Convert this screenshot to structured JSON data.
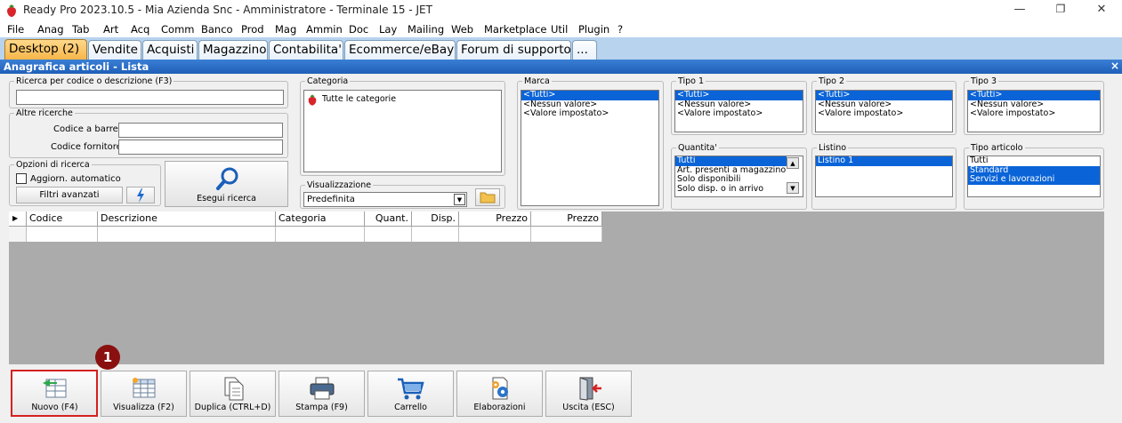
{
  "window": {
    "title": "Ready Pro 2023.10.5 - Mia Azienda Snc - Amministratore - Terminale 15 - JET",
    "minimize": "—",
    "restore": "❐",
    "close": "✕"
  },
  "menu": [
    "File",
    "Anag",
    "Tab",
    "Art",
    "Acq",
    "Comm",
    "Banco",
    "Prod",
    "Mag",
    "Ammin",
    "Doc",
    "Lay",
    "Mailing",
    "Web",
    "Marketplace",
    "Util",
    "Plugin",
    "?"
  ],
  "tabs": [
    "Desktop (2)",
    "Vendite",
    "Acquisti",
    "Magazzino",
    "Contabilita'",
    "Ecommerce/eBay",
    "Forum di supporto",
    "..."
  ],
  "panel": {
    "title": "Anagrafica articoli  - Lista",
    "close": "×"
  },
  "search": {
    "legend": "Ricerca per codice o descrizione (F3)",
    "value": ""
  },
  "other_search": {
    "legend": "Altre ricerche",
    "barcode_label": "Codice a barre :",
    "supplier_label": "Codice fornitore :"
  },
  "search_options": {
    "legend": "Opzioni di ricerca",
    "auto_update_label": "Aggiorn. automatico",
    "advanced_filters": "Filtri avanzati"
  },
  "search_button": "Esegui ricerca",
  "category": {
    "legend": "Categoria",
    "item": "Tutte le categorie"
  },
  "view": {
    "legend": "Visualizzazione",
    "value": "Predefinita"
  },
  "brand": {
    "legend": "Marca",
    "items": [
      "<Tutti>",
      "<Nessun valore>",
      "<Valore impostato>"
    ],
    "selected": 0
  },
  "type1": {
    "legend": "Tipo 1",
    "items": [
      "<Tutti>",
      "<Nessun valore>",
      "<Valore impostato>"
    ],
    "selected": 0
  },
  "type2": {
    "legend": "Tipo 2",
    "items": [
      "<Tutti>",
      "<Nessun valore>",
      "<Valore impostato>"
    ],
    "selected": 0
  },
  "type3": {
    "legend": "Tipo 3",
    "items": [
      "<Tutti>",
      "<Nessun valore>",
      "<Valore impostato>"
    ],
    "selected": 0
  },
  "quantity": {
    "legend": "Quantita'",
    "items": [
      "Tutti",
      "Art. presenti a magazzino",
      "Solo disponibili",
      "Solo disp. o in arrivo"
    ],
    "selected": 0
  },
  "pricelist": {
    "legend": "Listino",
    "items": [
      "Listino 1"
    ],
    "selected": 0
  },
  "article_type": {
    "legend": "Tipo articolo",
    "items": [
      "Tutti",
      "Standard",
      "Servizi e lavorazioni"
    ]
  },
  "grid": {
    "columns": [
      "Codice",
      "Descrizione",
      "Categoria",
      "Quant.",
      "Disp.",
      "Prezzo",
      "Prezzo"
    ]
  },
  "toolbar": {
    "new": "Nuovo (F4)",
    "view": "Visualizza (F2)",
    "duplicate": "Duplica (CTRL+D)",
    "print": "Stampa (F9)",
    "cart": "Carrello",
    "processing": "Elaborazioni",
    "exit": "Uscita (ESC)"
  },
  "badge": "1",
  "colors": {
    "selection": "#0a64d8",
    "active_tab": "#f7b64a",
    "header": "#1f5fb8",
    "highlight": "#d62020",
    "badge": "#8a1010"
  }
}
